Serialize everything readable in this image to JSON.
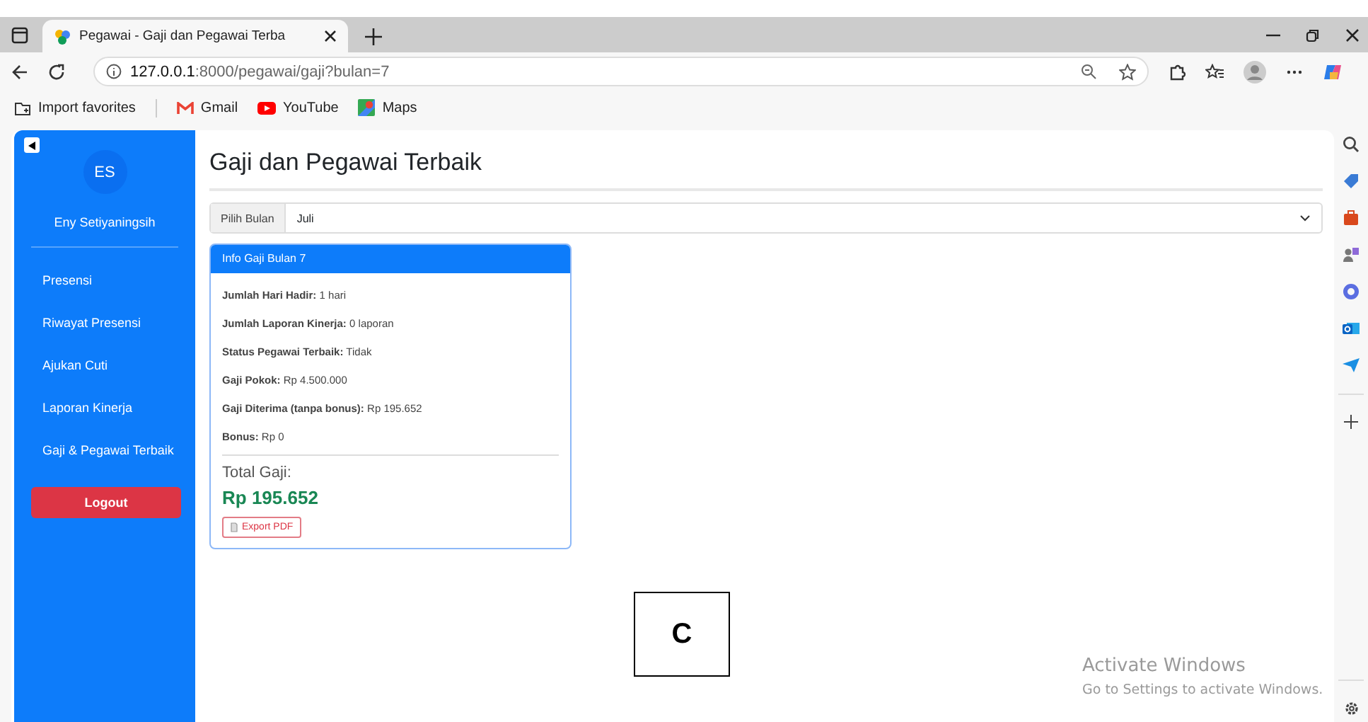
{
  "browser": {
    "tab": {
      "title": "Pegawai - Gaji dan Pegawai Terba",
      "selected": true
    },
    "address": "**127.0.0.1**:8000/pegawai/gaji?bulan=7",
    "bookmarks": [
      {
        "kind": "folder",
        "label": "Import favorites"
      },
      {
        "kind": "gmail",
        "label": "Gmail"
      },
      {
        "kind": "youtube",
        "label": "YouTube"
      },
      {
        "kind": "maps",
        "label": "Maps"
      }
    ]
  },
  "sidebar": {
    "avatar": "ES",
    "user": "Eny Setiyaningsih",
    "items": [
      "Presensi",
      "Riwayat Presensi",
      "Ajukan Cuti",
      "Laporan Kinerja",
      "Gaji & Pegawai Terbaik"
    ],
    "logout": "Logout"
  },
  "page": {
    "title": "Gaji dan Pegawai Terbaik",
    "month_select": {
      "label": "Pilih Bulan",
      "value": "Juli"
    },
    "card": {
      "header": "Info Gaji Bulan 7",
      "fields": [
        "**Jumlah Hari Hadir:** 1 hari",
        "**Jumlah Laporan Kinerja:** 0 laporan",
        "**Status Pegawai Terbaik:** Tidak",
        "**Gaji Pokok:** Rp 4.500.000",
        "**Gaji Diterima (tanpa bonus):** Rp 195.652",
        "**Bonus:** Rp 0"
      ],
      "total_label": "Total Gaji:",
      "total": "Rp 195.652",
      "export": "Export PDF"
    }
  },
  "figure_label": "C",
  "os_notice": {
    "title": "Activate Windows",
    "text": "Go to Settings to activate Windows."
  }
}
